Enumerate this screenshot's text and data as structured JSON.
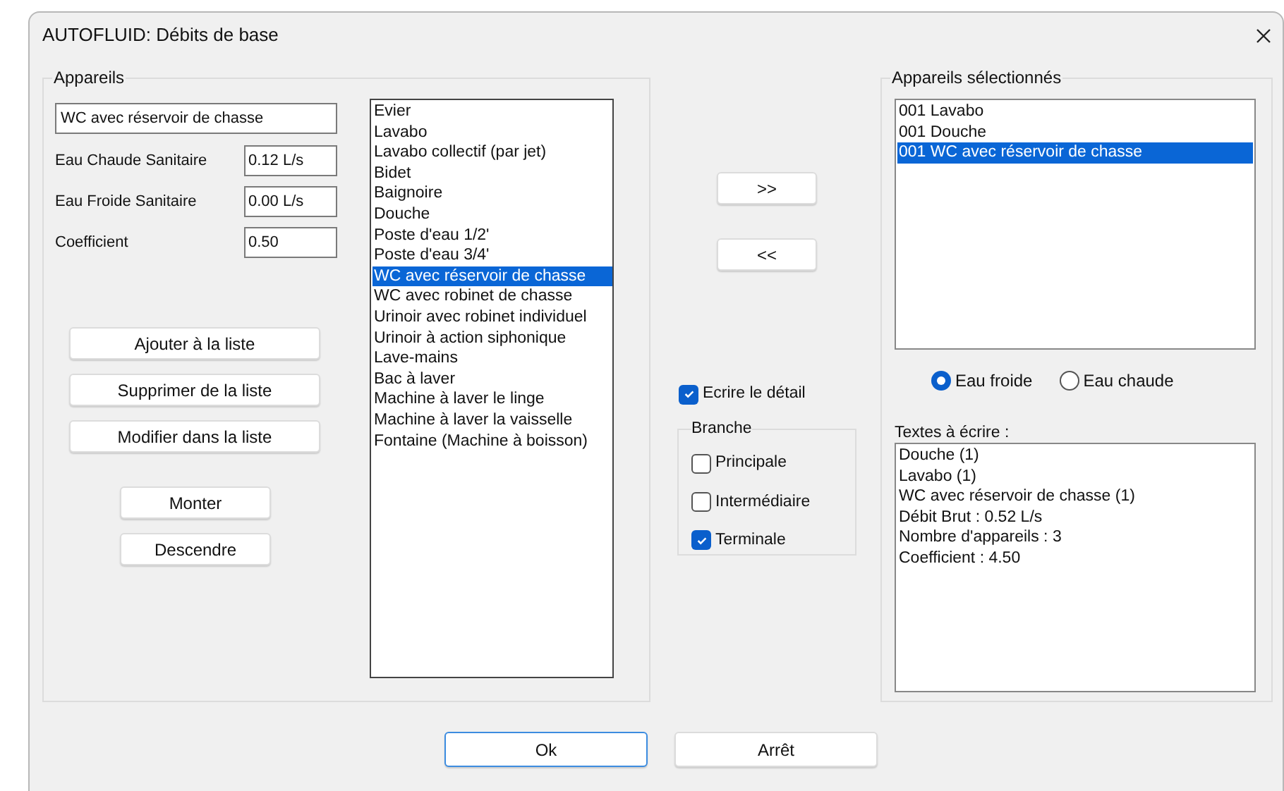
{
  "window": {
    "title": "AUTOFLUID: Débits de base"
  },
  "appareils": {
    "title": "Appareils",
    "name_field": {
      "value": "WC avec réservoir de chasse"
    },
    "fields": [
      {
        "label": "Eau Chaude Sanitaire",
        "value": "0.12 L/s"
      },
      {
        "label": "Eau Froide Sanitaire",
        "value": "0.00 L/s"
      },
      {
        "label": "Coefficient",
        "value": "0.50"
      }
    ],
    "list_buttons": [
      "Ajouter à la liste",
      "Supprimer de la liste",
      "Modifier dans la liste"
    ],
    "move_buttons": [
      "Monter",
      "Descendre"
    ],
    "catalog": [
      {
        "label": "Evier",
        "selected": false
      },
      {
        "label": "Lavabo",
        "selected": false
      },
      {
        "label": "Lavabo collectif (par jet)",
        "selected": false
      },
      {
        "label": "Bidet",
        "selected": false
      },
      {
        "label": "Baignoire",
        "selected": false
      },
      {
        "label": "Douche",
        "selected": false
      },
      {
        "label": "Poste d'eau 1/2'",
        "selected": false
      },
      {
        "label": "Poste d'eau 3/4'",
        "selected": false
      },
      {
        "label": "WC avec réservoir de chasse",
        "selected": true
      },
      {
        "label": "WC avec robinet de chasse",
        "selected": false
      },
      {
        "label": "Urinoir avec robinet individuel",
        "selected": false
      },
      {
        "label": "Urinoir à action siphonique",
        "selected": false
      },
      {
        "label": "Lave-mains",
        "selected": false
      },
      {
        "label": "Bac à laver",
        "selected": false
      },
      {
        "label": "Machine à laver le linge",
        "selected": false
      },
      {
        "label": "Machine à laver la vaisselle",
        "selected": false
      },
      {
        "label": "Fontaine (Machine à boisson)",
        "selected": false
      }
    ]
  },
  "transfer_buttons": [
    ">>",
    "<<"
  ],
  "write_detail": {
    "label": "Ecrire le détail",
    "checked": true
  },
  "branche": {
    "title": "Branche",
    "options": [
      {
        "label": "Principale",
        "checked": false
      },
      {
        "label": "Intermédiaire",
        "checked": false
      },
      {
        "label": "Terminale",
        "checked": true
      }
    ]
  },
  "selection": {
    "title": "Appareils sélectionnés",
    "items": [
      {
        "label": "001 Lavabo",
        "selected": false
      },
      {
        "label": "001 Douche",
        "selected": false
      },
      {
        "label": "001 WC avec réservoir de chasse",
        "selected": true
      }
    ],
    "water": [
      {
        "label": "Eau froide",
        "selected": true
      },
      {
        "label": "Eau chaude",
        "selected": false
      }
    ],
    "texts_label": "Textes à écrire :",
    "texts": [
      "Douche (1)",
      "Lavabo (1)",
      "WC avec réservoir de chasse (1)",
      "Débit Brut : 0.52 L/s",
      "Nombre d'appareils : 3",
      "Coefficient : 4.50"
    ]
  },
  "footer_buttons": [
    {
      "label": "Ok",
      "default": true
    },
    {
      "label": "Arrêt",
      "default": false
    }
  ]
}
